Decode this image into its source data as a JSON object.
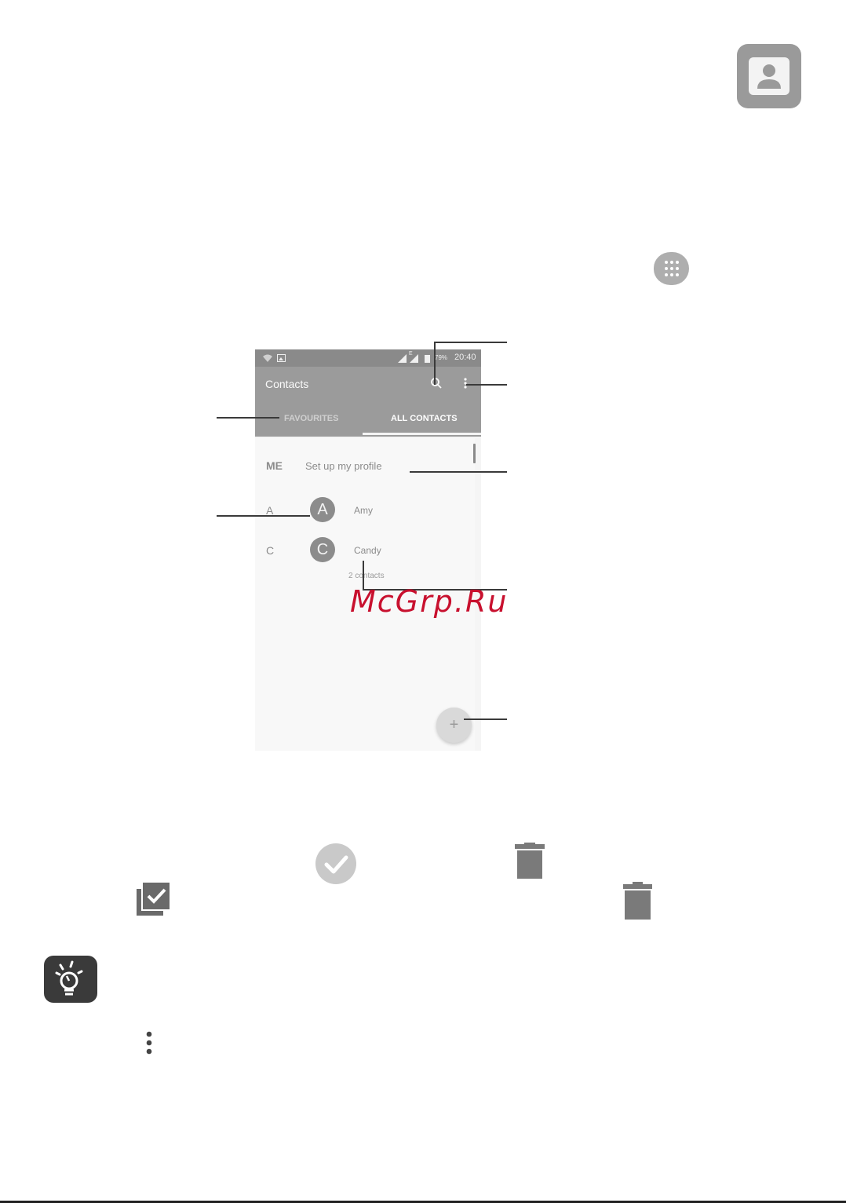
{
  "phone": {
    "status": {
      "battery": "79%",
      "time": "20:40",
      "network_type": "E"
    },
    "title": "Contacts",
    "tabs": {
      "favourites": "FAVOURITES",
      "all_contacts": "ALL CONTACTS"
    },
    "me_label": "ME",
    "me_text": "Set up my profile",
    "contacts": [
      {
        "section": "A",
        "initial": "A",
        "name": "Amy"
      },
      {
        "section": "C",
        "initial": "C",
        "name": "Candy"
      }
    ],
    "count_text": "2 contacts",
    "fab_symbol": "+"
  },
  "watermark": "McGrp.Ru",
  "icons": [
    "contacts-app-icon",
    "apps-drawer-icon",
    "check-circle-icon",
    "trash-icon",
    "select-all-icon",
    "tip-lightbulb-icon",
    "more-options-icon"
  ],
  "colors": {
    "watermark": "#c8102e",
    "app_bar": "#9b9b9b",
    "status_bar": "#8a8a8a"
  }
}
